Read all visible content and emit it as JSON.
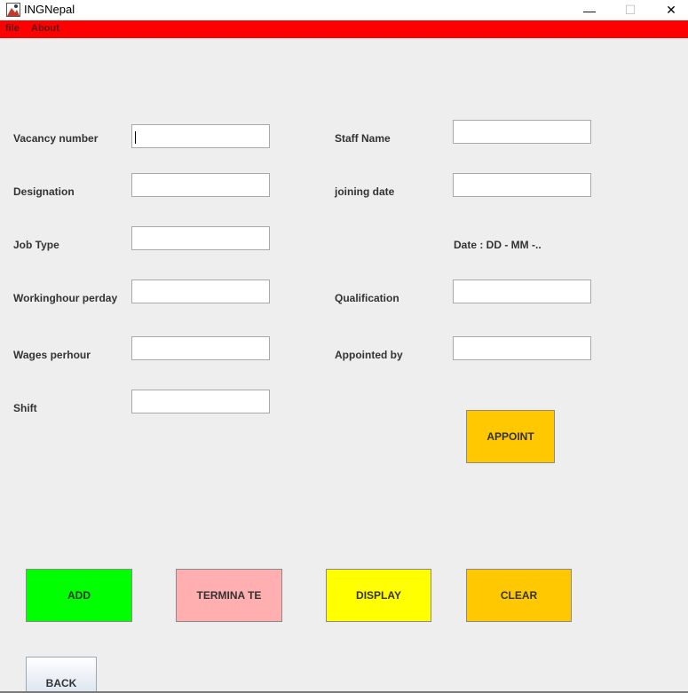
{
  "window": {
    "title": "INGNepal",
    "controls": {
      "minimize": "—",
      "maximize": "☐",
      "close": "✕"
    }
  },
  "menu": {
    "file": "file",
    "about": "About"
  },
  "form": {
    "vacancy_number": {
      "label": "Vacancy number",
      "value": ""
    },
    "designation": {
      "label": "Designation",
      "value": ""
    },
    "job_type": {
      "label": "Job Type",
      "value": ""
    },
    "working_hour": {
      "label": "Workinghour perday",
      "value": ""
    },
    "wages": {
      "label": "Wages perhour",
      "value": ""
    },
    "shift": {
      "label": "Shift",
      "value": ""
    },
    "staff_name": {
      "label": "Staff Name",
      "value": ""
    },
    "joining_date": {
      "label": "joining date",
      "value": "",
      "hint": "Date : DD - MM -.."
    },
    "qualification": {
      "label": "Qualification",
      "value": ""
    },
    "appointed_by": {
      "label": "Appointed by",
      "value": ""
    }
  },
  "buttons": {
    "appoint": "APPOINT",
    "add": "ADD",
    "terminate": "TERMINA TE",
    "display": "DISPLAY",
    "clear": "CLEAR",
    "back": "BACK"
  },
  "colors": {
    "menubar": "#ff0000",
    "appoint": "#ffc800",
    "add": "#00ff00",
    "terminate": "#ffafaf",
    "display": "#ffff00",
    "clear": "#ffc800",
    "background": "#eeeeee"
  }
}
